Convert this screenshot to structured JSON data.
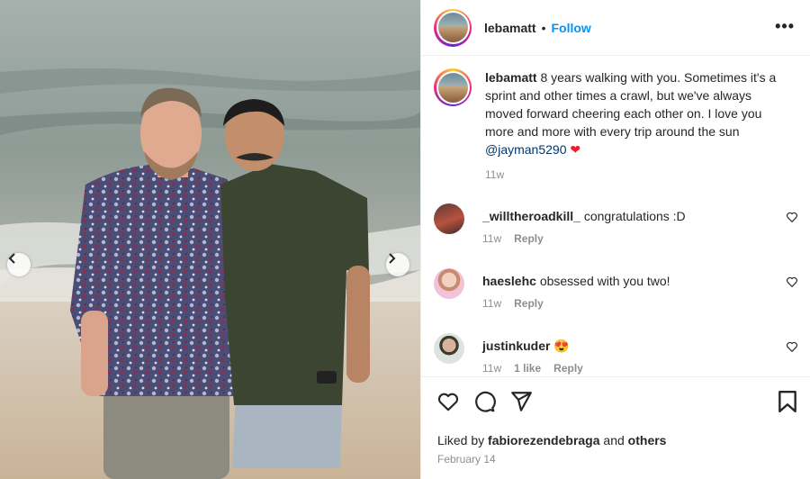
{
  "post": {
    "author": "lebamatt",
    "follow_label": "Follow",
    "separator": "•",
    "more_label": "•••",
    "caption": {
      "username": "lebamatt",
      "text": " 8 years walking with you. Sometimes it's a sprint and other times a crawl, but we've always moved forward cheering each other on. I love you more and more with every trip around the sun ",
      "mention": "@jayman5290",
      "emoji": "❤",
      "time": "11w"
    },
    "comments": [
      {
        "username": "_willtheroadkill_",
        "text": " congratulations :D",
        "time": "11w",
        "likes": "",
        "reply_label": "Reply"
      },
      {
        "username": "haeslehc",
        "text": " obsessed with you two!",
        "time": "11w",
        "likes": "",
        "reply_label": "Reply"
      },
      {
        "username": "justinkuder",
        "text": " 😍",
        "time": "11w",
        "likes": "1 like",
        "reply_label": "Reply"
      }
    ],
    "liked_by": {
      "prefix": "Liked by ",
      "user": "fabiorezendebraga",
      "joiner": " and ",
      "others": "others"
    },
    "date": "February 14"
  },
  "icons": {
    "like": "heart-outline-icon",
    "comment": "comment-bubble-icon",
    "share": "paper-plane-icon",
    "save": "bookmark-icon",
    "prev": "chevron-left-icon",
    "next": "chevron-right-icon"
  },
  "colors": {
    "accent": "#0095f6",
    "mention": "#00376b",
    "heart": "#ed1c2e",
    "muted": "#8e8e8e"
  }
}
